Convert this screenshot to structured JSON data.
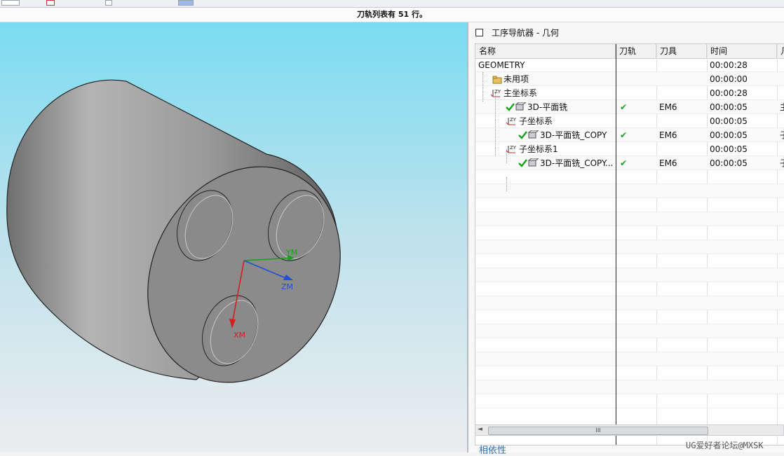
{
  "status_message": "刀轨列表有 51 行。",
  "navigator": {
    "title": "工序导航器 - 几何",
    "columns": [
      "名称",
      "刀轨",
      "刀具",
      "时间",
      "几"
    ],
    "rows": [
      {
        "name": "GEOMETRY",
        "path": "",
        "tool": "",
        "time": "00:00:28",
        "extra": "",
        "icon": "none"
      },
      {
        "name": "未用项",
        "path": "",
        "tool": "",
        "time": "00:00:00",
        "extra": "",
        "icon": "folder-icon"
      },
      {
        "name": "主坐标系",
        "path": "",
        "tool": "",
        "time": "00:00:28",
        "extra": "",
        "icon": "mcs-icon"
      },
      {
        "name": "3D-平面铣",
        "path": "✔",
        "tool": "EM6",
        "time": "00:00:05",
        "extra": "主",
        "icon": "operation-icon"
      },
      {
        "name": "子坐标系",
        "path": "",
        "tool": "",
        "time": "00:00:05",
        "extra": "",
        "icon": "mcs-icon"
      },
      {
        "name": "3D-平面铣_COPY",
        "path": "✔",
        "tool": "EM6",
        "time": "00:00:05",
        "extra": "子",
        "icon": "operation-icon"
      },
      {
        "name": "子坐标系1",
        "path": "",
        "tool": "",
        "time": "00:00:05",
        "extra": "",
        "icon": "mcs-icon"
      },
      {
        "name": "3D-平面铣_COPY...",
        "path": "✔",
        "tool": "EM6",
        "time": "00:00:05",
        "extra": "子",
        "icon": "operation-icon"
      }
    ],
    "scroll_thumb": "III",
    "dependency_link": "相依性"
  },
  "viewport": {
    "axis_labels": {
      "ym": "YM",
      "zm": "ZM",
      "xm": "XM"
    },
    "colors": {
      "x_axis": "#d22020",
      "y_axis": "#1aa01a",
      "z_axis": "#1f4fd6",
      "body": "#8a8a8a"
    }
  },
  "watermark": "UG爱好者论坛@MXSK"
}
